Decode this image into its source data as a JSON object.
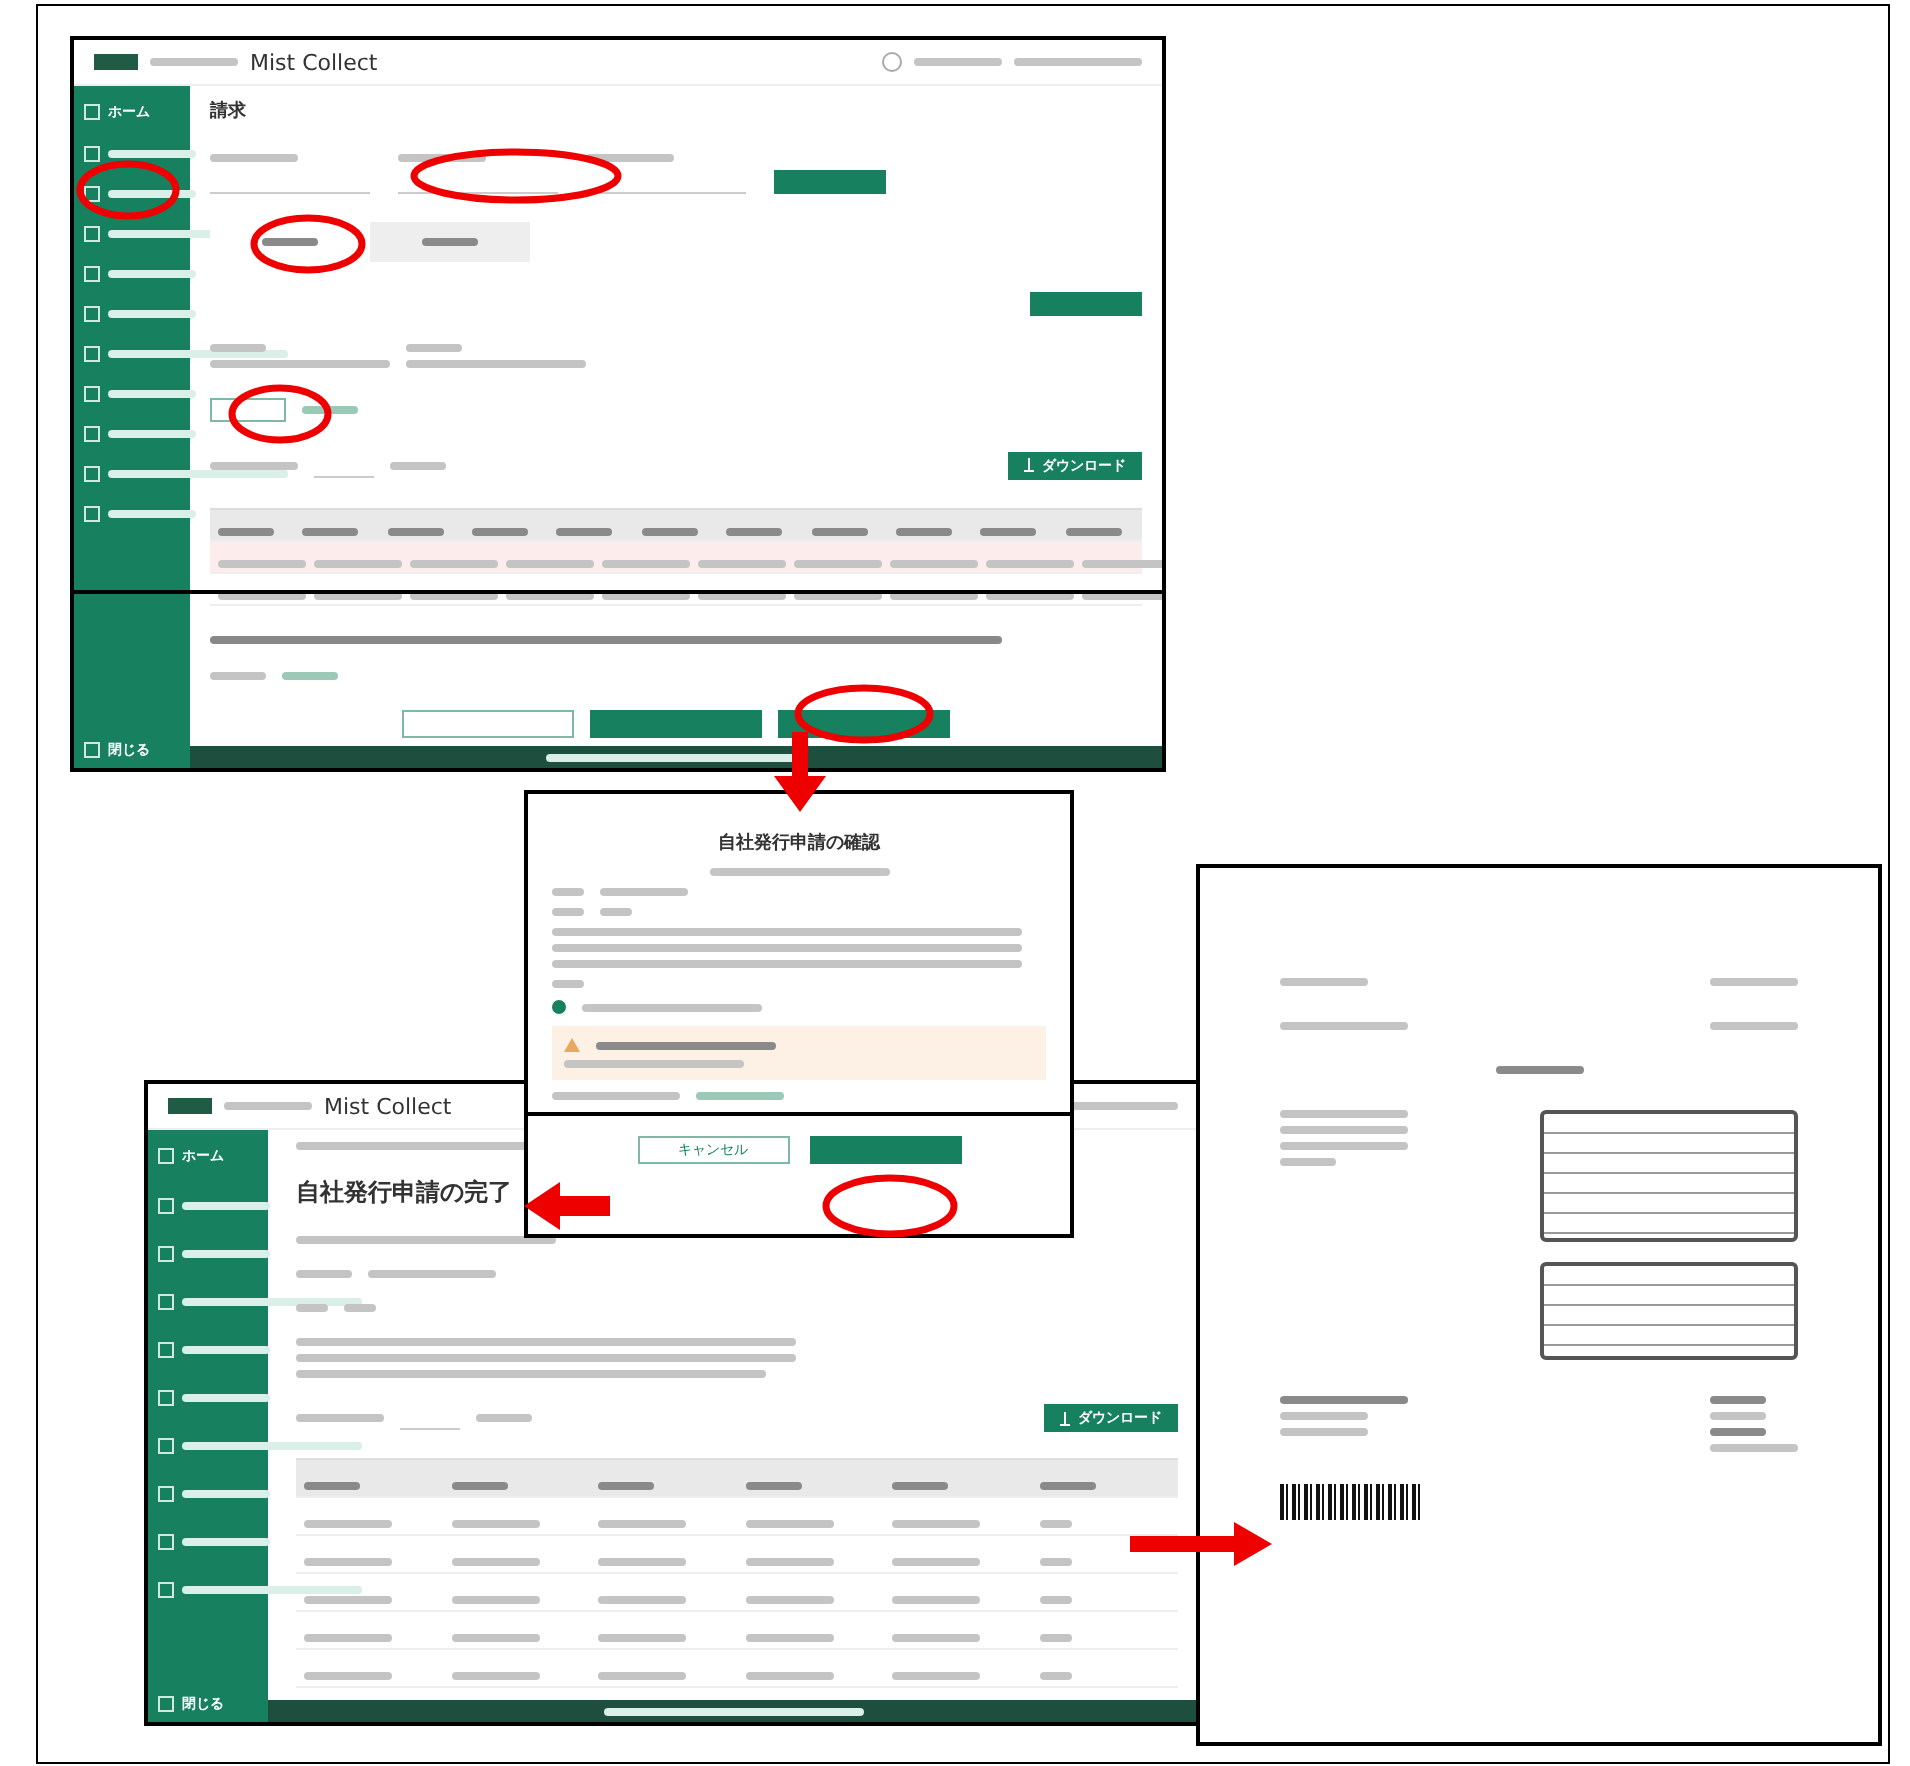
{
  "screens": [
    {
      "kind": "list",
      "app_name": "Mist Collect",
      "sidebar": {
        "items": [
          "ホーム"
        ],
        "close": "閉じる"
      },
      "page_title": "請求",
      "download": "ダウンロード"
    },
    {
      "kind": "dialog",
      "title": "自社発行申請の確認",
      "radio_selected": true,
      "cancel": "キャンセル"
    },
    {
      "kind": "done",
      "app_name": "Mist Collect",
      "sidebar": {
        "items": [
          "ホーム"
        ],
        "close": "閉じる"
      },
      "page_title": "自社発行申請の完了",
      "download": "ダウンロード"
    },
    {
      "kind": "document"
    }
  ]
}
